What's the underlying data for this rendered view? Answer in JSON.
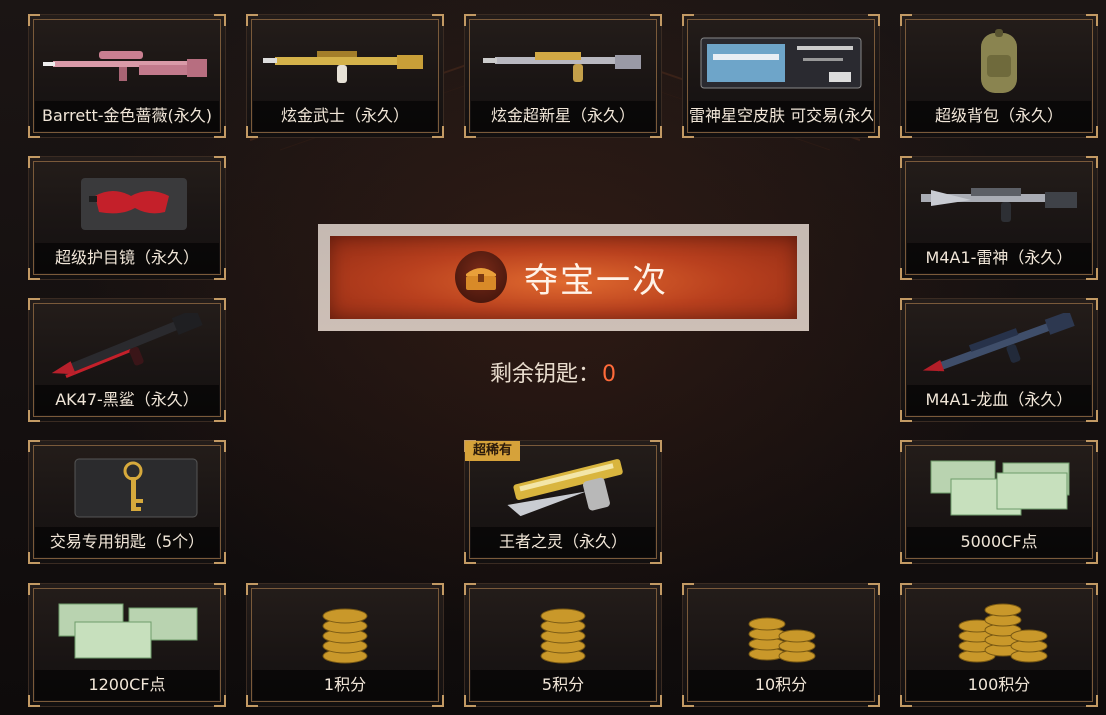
{
  "grid_items": [
    {
      "label": "Barrett-金色蔷薇(永久)",
      "icon": "pink-sniper-rifle-icon"
    },
    {
      "label": "炫金武士（永久）",
      "icon": "gold-rifle-icon"
    },
    {
      "label": "炫金超新星（永久）",
      "icon": "gold-rifle-icon"
    },
    {
      "label": "雷神星空皮肤 可交易(永久)",
      "icon": "skin-voucher-card-icon"
    },
    {
      "label": "超级背包（永久）",
      "icon": "backpack-icon"
    },
    {
      "label": "超级护目镜（永久）",
      "icon": "goggles-icon"
    },
    {
      "label": "M4A1-雷神（永久）",
      "icon": "rifle-icon"
    },
    {
      "label": "AK47-黑鲨（永久）",
      "icon": "black-shark-rifle-icon"
    },
    {
      "label": "M4A1-龙血（永久）",
      "icon": "dragon-blood-rifle-icon"
    },
    {
      "label": "交易专用钥匙（5个）",
      "icon": "gold-key-icon"
    },
    {
      "label": "王者之灵（永久）",
      "icon": "gold-pistol-icon",
      "badge": "超稀有"
    },
    {
      "label": "5000CF点",
      "icon": "cf-points-bills-icon"
    },
    {
      "label": "1200CF点",
      "icon": "cf-points-bills-icon"
    },
    {
      "label": "1积分",
      "icon": "coin-stack-icon"
    },
    {
      "label": "5积分",
      "icon": "coin-stack-icon"
    },
    {
      "label": "10积分",
      "icon": "coin-stacks-icon"
    },
    {
      "label": "100积分",
      "icon": "coin-stacks-icon"
    }
  ],
  "draw_button": {
    "label": "夺宝一次",
    "icon": "treasure-chest-icon"
  },
  "keys": {
    "label": "剩余钥匙：",
    "count": "0"
  },
  "colors": {
    "accent": "#c39a64",
    "button": "#c0461f",
    "count": "#ff6b3a",
    "badge": "#d6a23a"
  }
}
